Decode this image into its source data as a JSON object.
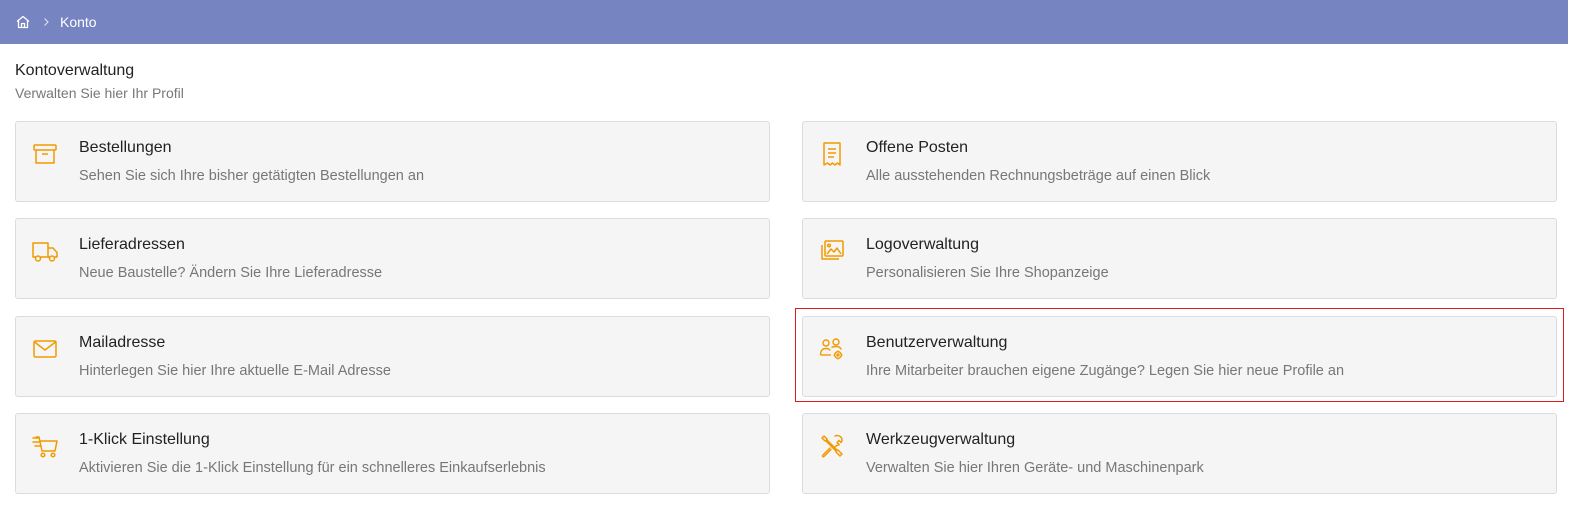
{
  "breadcrumb": {
    "home_icon": "home-icon",
    "separator_icon": "chevron-right-icon",
    "current": "Konto"
  },
  "page": {
    "title": "Kontoverwaltung",
    "subtitle": "Verwalten Sie hier Ihr Profil"
  },
  "accent_color": "#f29a00",
  "topbar_color": "#7684c2",
  "highlight_color": "#e01b1b",
  "cards": [
    {
      "icon": "archive-box-icon",
      "title": "Bestellungen",
      "description": "Sehen Sie sich Ihre bisher getätigten Bestellungen an"
    },
    {
      "icon": "receipt-icon",
      "title": "Offene Posten",
      "description": "Alle ausstehenden Rechnungsbeträge auf einen Blick"
    },
    {
      "icon": "truck-icon",
      "title": "Lieferadressen",
      "description": "Neue Baustelle? Ändern Sie Ihre Lieferadresse"
    },
    {
      "icon": "image-gallery-icon",
      "title": "Logoverwaltung",
      "description": "Personalisieren Sie Ihre Shopanzeige"
    },
    {
      "icon": "envelope-icon",
      "title": "Mailadresse",
      "description": "Hinterlegen Sie hier Ihre aktuelle E-Mail Adresse"
    },
    {
      "icon": "users-settings-icon",
      "title": "Benutzerverwaltung",
      "description": "Ihre Mitarbeiter brauchen eigene Zugänge? Legen Sie hier neue Profile an"
    },
    {
      "icon": "fast-cart-icon",
      "title": "1-Klick Einstellung",
      "description": "Aktivieren Sie die 1-Klick Einstellung für ein schnelleres Einkaufserlebnis"
    },
    {
      "icon": "tools-icon",
      "title": "Werkzeugverwaltung",
      "description": "Verwalten Sie hier Ihren Geräte- und Maschinenpark"
    }
  ]
}
